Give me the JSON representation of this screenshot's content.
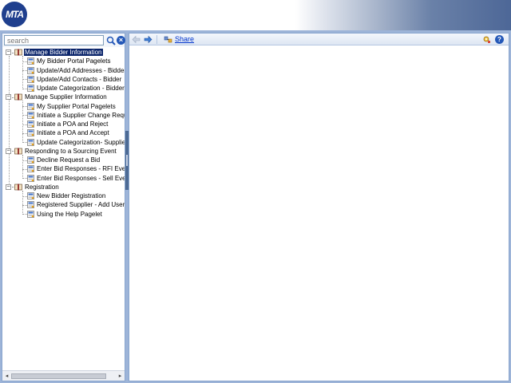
{
  "header": {
    "logo_text": "MTA"
  },
  "search": {
    "placeholder": "search",
    "search_icon": "magnifier-icon",
    "clear_icon": "close-icon",
    "clear_glyph": "×"
  },
  "tree": {
    "groups": [
      {
        "label": "Manage Bidder Information",
        "selected": true,
        "items": [
          "My Bidder Portal Pagelets",
          "Update/Add Addresses - Bidder",
          "Update/Add Contacts - Bidder",
          "Update Categorization - Bidder"
        ]
      },
      {
        "label": "Manage Supplier Information",
        "selected": false,
        "items": [
          "My Supplier Portal Pagelets",
          "Initiate a Supplier Change Reques",
          "Initiate a POA and Reject",
          "Initiate a POA and Accept",
          "Update Categorization- Supplier"
        ]
      },
      {
        "label": "Responding to a Sourcing Event",
        "selected": false,
        "items": [
          "Decline Request a Bid",
          "Enter Bid Responses - RFI Event",
          "Enter Bid Responses - Sell Event"
        ]
      },
      {
        "label": "Registration",
        "selected": false,
        "items": [
          "New Bidder Registration",
          "Registered Supplier - Add User Ac",
          "Using the Help Pagelet"
        ]
      }
    ]
  },
  "toolbar": {
    "share_label": "Share",
    "help_glyph": "?"
  },
  "scrollbar": {
    "left_arrow": "◂",
    "right_arrow": "▸"
  },
  "colors": {
    "header_gradient_end": "#4d6797",
    "frame_band": "#9db4d8",
    "selection": "#0a246a",
    "link": "#0033cc",
    "brand_blue": "#1f3f8e"
  }
}
